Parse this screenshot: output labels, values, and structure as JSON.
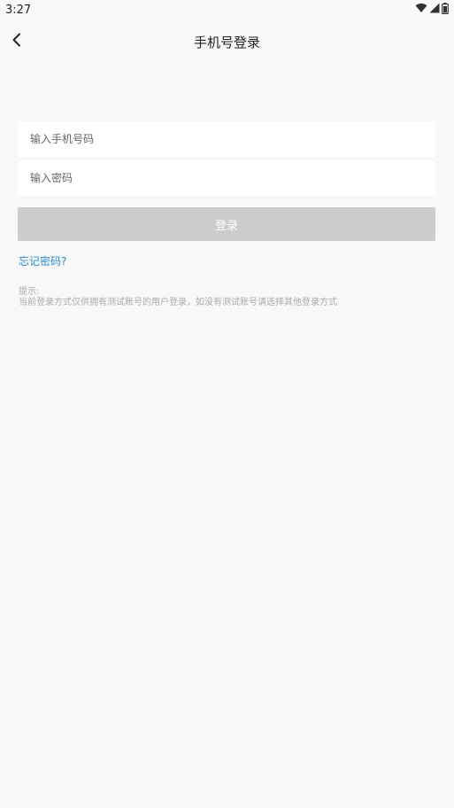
{
  "status_bar": {
    "time": "3:27"
  },
  "nav": {
    "title": "手机号登录"
  },
  "form": {
    "phone_placeholder": "输入手机号码",
    "phone_value": "",
    "password_placeholder": "输入密码",
    "password_value": "",
    "login_label": "登录",
    "forgot_label": "忘记密码?"
  },
  "tip": {
    "label": "提示:",
    "text": "当前登录方式仅供拥有测试账号的用户登录，如没有测试账号请选择其他登录方式"
  },
  "colors": {
    "background": "#f8f8f8",
    "button_disabled": "#cccccc",
    "link": "#2a8cd6",
    "tip_text": "#aaaaaa"
  },
  "icons": [
    "wifi-icon",
    "signal-icon",
    "battery-icon",
    "back-arrow-icon"
  ]
}
